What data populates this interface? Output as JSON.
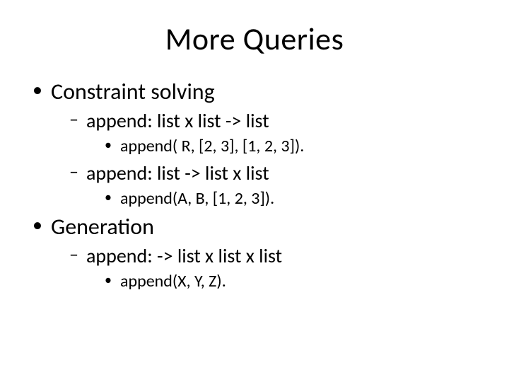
{
  "title": "More  Queries",
  "bullets": [
    {
      "label": "Constraint solving",
      "sub": [
        {
          "label": "append:  list x list -> list",
          "sub": [
            {
              "label": "append( R, [2, 3], [1, 2, 3])."
            }
          ]
        },
        {
          "label": "append:  list  ->  list x list",
          "sub": [
            {
              "label": "append(A, B, [1, 2, 3])."
            }
          ]
        }
      ]
    },
    {
      "label": "Generation",
      "sub": [
        {
          "label": "append:   ->  list x list  x list",
          "sub": [
            {
              "label": "append(X, Y, Z)."
            }
          ]
        }
      ]
    }
  ]
}
